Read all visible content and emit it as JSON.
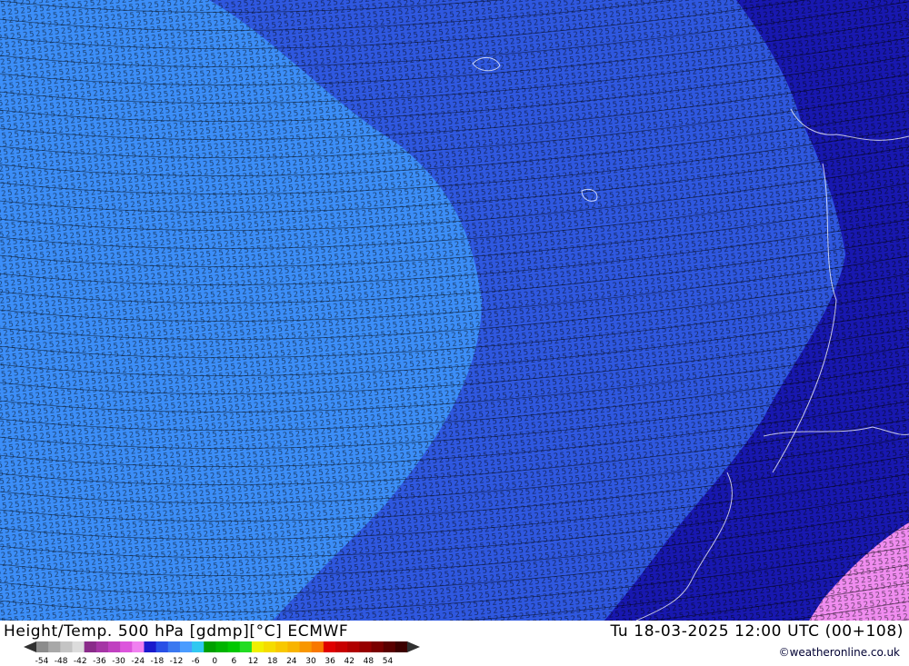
{
  "header": {
    "title": "Height/Temp. 500 hPa [gdmp][°C] ECMWF",
    "valid_time": "Tu 18-03-2025 12:00 UTC (00+108)",
    "credit": "©weatheronline.co.uk"
  },
  "legend": {
    "ticks": [
      "-54",
      "-48",
      "-42",
      "-36",
      "-30",
      "-24",
      "-18",
      "-12",
      "-6",
      "0",
      "6",
      "12",
      "18",
      "24",
      "30",
      "36",
      "42",
      "48",
      "54"
    ],
    "colors": [
      "#8c8c8c",
      "#a8a8a8",
      "#c4c4c4",
      "#dcdcdc",
      "#8a2b8a",
      "#a535a5",
      "#c040c0",
      "#dc55dc",
      "#f080f0",
      "#1a1acc",
      "#2850e6",
      "#3a78f0",
      "#4a9cff",
      "#30c8f0",
      "#00a000",
      "#00b400",
      "#00c800",
      "#22dc22",
      "#f0f000",
      "#f5dc00",
      "#f8c800",
      "#f8b400",
      "#f89600",
      "#f87800",
      "#e00000",
      "#c80000",
      "#b00000",
      "#960000",
      "#7a0000",
      "#5a0000",
      "#3c0000"
    ],
    "arrow_color": "#303030"
  },
  "map": {
    "fill_colors": {
      "light_blue": "#3c8ef8",
      "mid_blue": "#2f58e0",
      "dark_blue": "#1818b0",
      "pink": "#f08cf0"
    },
    "contour_label_pattern": [
      "5",
      "5",
      "2",
      "5",
      "5",
      "2",
      "5",
      "5",
      "2",
      "5"
    ],
    "coast_color": "#ffffff"
  }
}
